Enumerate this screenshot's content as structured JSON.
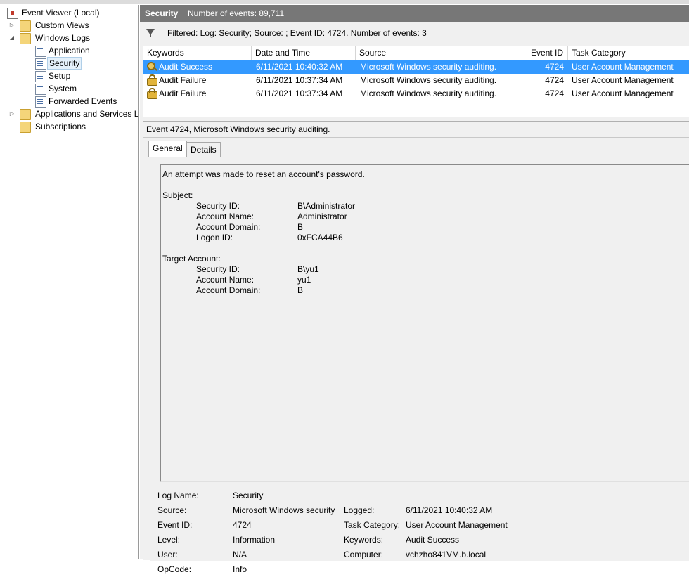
{
  "tree": {
    "root": "Event Viewer (Local)",
    "custom_views": "Custom Views",
    "windows_logs": "Windows Logs",
    "application": "Application",
    "security": "Security",
    "setup": "Setup",
    "system": "System",
    "forwarded_events": "Forwarded Events",
    "applications_services": "Applications and Services L",
    "subscriptions": "Subscriptions"
  },
  "header": {
    "log_name": "Security",
    "event_count": "Number of events: 89,711"
  },
  "filter": {
    "text": "Filtered: Log: Security; Source: ; Event ID: 4724. Number of events: 3"
  },
  "grid": {
    "columns": {
      "keywords": "Keywords",
      "date_time": "Date and Time",
      "source": "Source",
      "event_id": "Event ID",
      "task_category": "Task Category"
    },
    "rows": [
      {
        "keywords": "Audit Success",
        "date_time": "6/11/2021 10:40:32 AM",
        "source": "Microsoft Windows security auditing.",
        "event_id": "4724",
        "task_category": "User Account Management",
        "icon": "key-icon"
      },
      {
        "keywords": "Audit Failure",
        "date_time": "6/11/2021 10:37:34 AM",
        "source": "Microsoft Windows security auditing.",
        "event_id": "4724",
        "task_category": "User Account Management",
        "icon": "lock-icon"
      },
      {
        "keywords": "Audit Failure",
        "date_time": "6/11/2021 10:37:34 AM",
        "source": "Microsoft Windows security auditing.",
        "event_id": "4724",
        "task_category": "User Account Management",
        "icon": "lock-icon"
      }
    ]
  },
  "detail": {
    "title": "Event 4724, Microsoft Windows security auditing.",
    "tabs": {
      "general": "General",
      "details": "Details"
    },
    "description": {
      "summary": "An attempt was made to reset an account's password.",
      "subject_header": "Subject:",
      "subject": {
        "security_id_label": "Security ID:",
        "security_id": "B\\Administrator",
        "account_name_label": "Account Name:",
        "account_name": "Administrator",
        "account_domain_label": "Account Domain:",
        "account_domain": "B",
        "logon_id_label": "Logon ID:",
        "logon_id": "0xFCA44B6"
      },
      "target_header": "Target Account:",
      "target": {
        "security_id_label": "Security ID:",
        "security_id": "B\\yu1",
        "account_name_label": "Account Name:",
        "account_name": "yu1",
        "account_domain_label": "Account Domain:",
        "account_domain": "B"
      }
    },
    "properties": {
      "log_name_label": "Log Name:",
      "log_name": "Security",
      "source_label": "Source:",
      "source": "Microsoft Windows security",
      "logged_label": "Logged:",
      "logged": "6/11/2021 10:40:32 AM",
      "event_id_label": "Event ID:",
      "event_id": "4724",
      "task_category_label": "Task Category:",
      "task_category": "User Account Management",
      "level_label": "Level:",
      "level": "Information",
      "keywords_label": "Keywords:",
      "keywords": "Audit Success",
      "user_label": "User:",
      "user": "N/A",
      "computer_label": "Computer:",
      "computer": "vchzho841VM.b.local",
      "opcode_label": "OpCode:",
      "opcode": "Info"
    }
  },
  "colors": {
    "selection": "#3399ff",
    "title_bar": "#777777",
    "pane_background": "#f0f0f0"
  }
}
